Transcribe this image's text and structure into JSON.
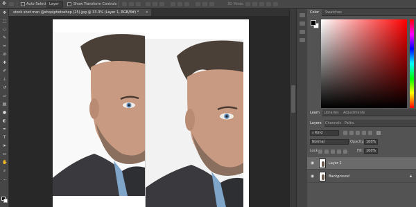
{
  "options_bar": {
    "auto_select_label": "Auto-Select:",
    "auto_select_target": "Layer",
    "show_transform_label": "Show Transform Controls",
    "mode_3d_label": "3D Mode:"
  },
  "document_tab": {
    "title": "stock shot man @shopiphotoshop (25).jpg @ 33.3% (Layer 1, RGB/8#) *",
    "close_glyph": "×"
  },
  "tools": [
    "move-icon",
    "marquee-icon",
    "lasso-icon",
    "quick-select-icon",
    "crop-icon",
    "eyedropper-icon",
    "healing-icon",
    "brush-icon",
    "clone-stamp-icon",
    "history-brush-icon",
    "eraser-icon",
    "gradient-icon",
    "blur-icon",
    "dodge-icon",
    "pen-icon",
    "type-icon",
    "path-select-icon",
    "shape-icon",
    "hand-icon",
    "zoom-icon",
    "more-icon"
  ],
  "color_panel": {
    "tabs": [
      "Color",
      "Swatches"
    ],
    "active_tab": "Color",
    "foreground": "#000000",
    "background": "#ffffff",
    "hue": "#ff0000"
  },
  "libraries_tabs": [
    "Learn",
    "Libraries",
    "Adjustments"
  ],
  "layers_panel": {
    "tabs": [
      "Layers",
      "Channels",
      "Paths"
    ],
    "active_tab": "Layers",
    "filter_label": "Kind",
    "blend_mode": "Normal",
    "opacity_label": "Opacity:",
    "opacity_value": "100%",
    "lock_label": "Lock:",
    "fill_label": "Fill:",
    "fill_value": "100%",
    "layers": [
      {
        "name": "Layer 1",
        "selected": true,
        "italic": false,
        "locked": false
      },
      {
        "name": "Background",
        "selected": false,
        "italic": true,
        "locked": true
      }
    ]
  }
}
